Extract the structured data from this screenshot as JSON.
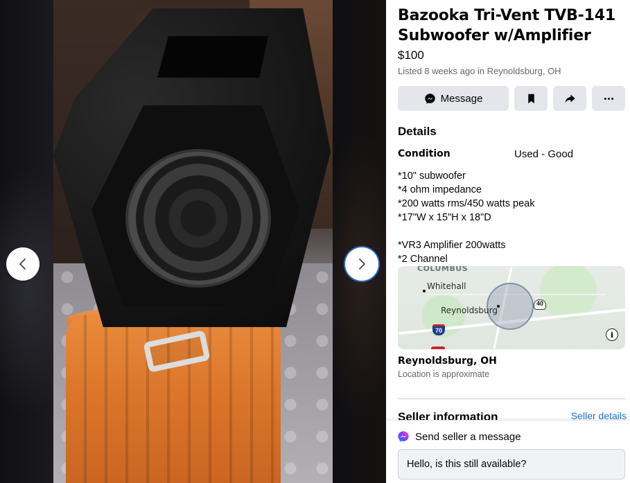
{
  "viewer": {
    "prev_icon": "chevron-left-icon",
    "next_icon": "chevron-right-icon"
  },
  "listing": {
    "title": "Bazooka Tri-Vent TVB-141 Subwoofer w/Amplifier",
    "price": "$100",
    "listed": "Listed 8 weeks ago in Reynoldsburg, OH"
  },
  "actions": {
    "message_label": "Message",
    "message_icon": "messenger-icon",
    "save_icon": "bookmark-icon",
    "share_icon": "share-icon",
    "more_icon": "more-icon"
  },
  "details": {
    "heading": "Details",
    "condition_label": "Condition",
    "condition_value": "Used - Good",
    "description": "*10\" subwoofer\n*4 ohm impedance\n*200 watts rms/450 watts peak\n*17\"W x 15\"H x 18\"D\n\n*VR3 Amplifier 200watts\n*2 Channel"
  },
  "map": {
    "label_columbus": "COLUMBUS",
    "label_whitehall": "Whitehall",
    "label_reynoldsburg": "Reynoldsburg",
    "shield_70": "70",
    "shield_40": "40",
    "info_icon": "info-icon"
  },
  "location": {
    "name": "Reynoldsburg, OH",
    "note": "Location is approximate"
  },
  "seller": {
    "heading": "Seller information",
    "details_link": "Seller details"
  },
  "message_box": {
    "heading": "Send seller a message",
    "icon": "messenger-icon",
    "input_value": "Hello, is this still available?"
  },
  "colors": {
    "link": "#216fdb",
    "button_bg": "#e4e6eb",
    "secondary_text": "#65676b"
  }
}
